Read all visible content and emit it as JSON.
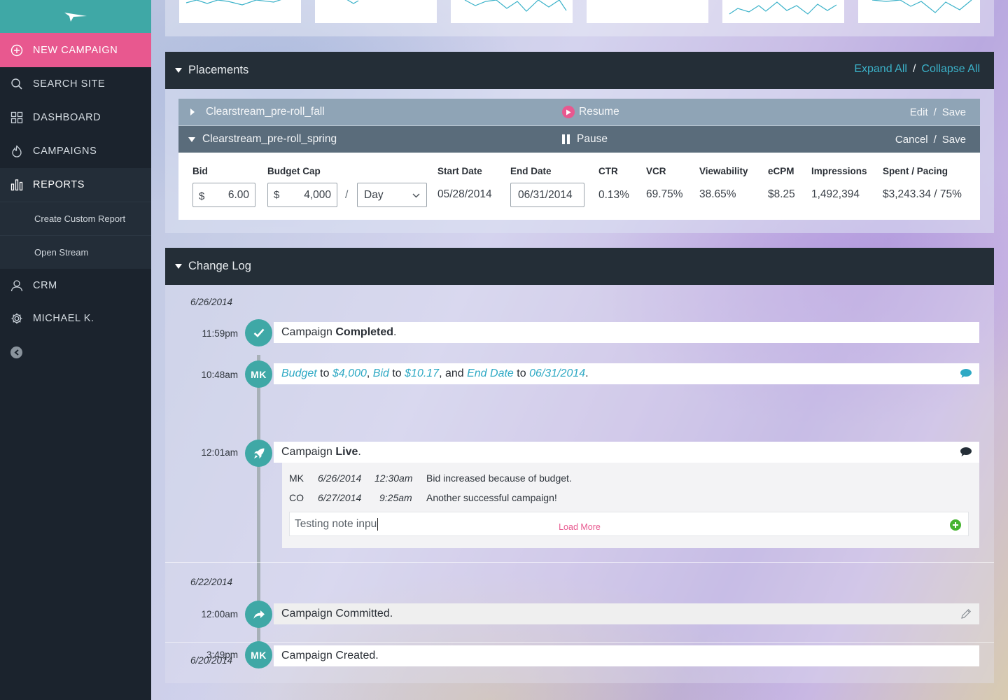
{
  "sidebar": {
    "items": [
      {
        "label": "NEW CAMPAIGN",
        "icon": "plus-circle-icon"
      },
      {
        "label": "SEARCH SITE",
        "icon": "search-icon"
      },
      {
        "label": "DASHBOARD",
        "icon": "grid-icon"
      },
      {
        "label": "CAMPAIGNS",
        "icon": "flame-icon"
      },
      {
        "label": "REPORTS",
        "icon": "bar-chart-icon"
      },
      {
        "label": "CRM",
        "icon": "user-icon"
      },
      {
        "label": "MICHAEL K.",
        "icon": "gear-icon"
      }
    ],
    "report_subitems": [
      "Create Custom Report",
      "Open Stream"
    ],
    "colors": {
      "accent_teal": "#3fa8a6",
      "new_campaign_pink": "#e8588f",
      "sidebar_bg": "#1b232d"
    }
  },
  "placements": {
    "title": "Placements",
    "expand_all": "Expand All",
    "separator": "/",
    "collapse_all": "Collapse All",
    "rows": [
      {
        "name": "Clearstream_pre-roll_fall",
        "status_action": "Resume",
        "action_1": "Edit",
        "action_2": "Save"
      },
      {
        "name": "Clearstream_pre-roll_spring",
        "status_action": "Pause",
        "action_1": "Cancel",
        "action_2": "Save"
      }
    ],
    "detail": {
      "labels": {
        "bid": "Bid",
        "budget_cap": "Budget Cap",
        "start_date": "Start Date",
        "end_date": "End Date",
        "ctr": "CTR",
        "vcr": "VCR",
        "viewability": "Viewability",
        "ecpm": "eCPM",
        "impressions": "Impressions",
        "spent_pacing": "Spent / Pacing"
      },
      "currency": "$",
      "bid": "6.00",
      "budget_cap": "4,000",
      "per": "/",
      "period": "Day",
      "start_date": "05/28/2014",
      "end_date": "06/31/2014",
      "ctr": "0.13%",
      "vcr": "69.75%",
      "viewability": "38.65%",
      "ecpm": "$8.25",
      "impressions": "1,492,394",
      "spent_pacing": "$3,243.34 / 75%"
    }
  },
  "changelog": {
    "title": "Change Log",
    "groups": [
      {
        "date": "6/26/2014"
      },
      {
        "date": "6/22/2014"
      },
      {
        "date": "6/20/2014"
      }
    ],
    "entries": {
      "completed": {
        "time": "11:59pm",
        "pre": "Campaign ",
        "bold": "Completed",
        "post": "."
      },
      "budget": {
        "time": "10:48am",
        "avatar": "MK",
        "f1": "Budget",
        "t1": " to ",
        "v1": "$4,000",
        "c1": ", ",
        "f2": "Bid",
        "t2": " to ",
        "v2": "$10.17",
        "c2": ", and ",
        "f3": "End Date",
        "t3": " to ",
        "v3": "06/31/2014",
        "end": "."
      },
      "live": {
        "time": "12:01am",
        "pre": "Campaign ",
        "bold": "Live",
        "post": "."
      },
      "committed": {
        "time": "12:00am",
        "text": "Campaign Committed."
      },
      "created": {
        "time": "3:49pm",
        "avatar": "MK",
        "text": "Campaign Created."
      }
    },
    "notes": [
      {
        "user": "MK",
        "date": "6/26/2014",
        "time": "12:30am",
        "text": "Bid increased because of budget."
      },
      {
        "user": "CO",
        "date": "6/27/2014",
        "time": "9:25am",
        "text": "Another successful campaign!"
      }
    ],
    "note_input_value": "Testing note inpu",
    "load_more": "Load More"
  }
}
